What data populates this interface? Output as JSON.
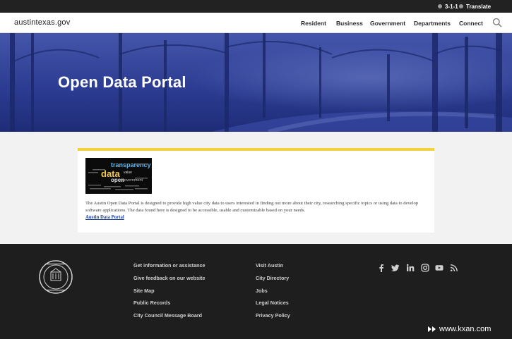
{
  "utility": {
    "item1": "3-1-1",
    "item2": "Translate"
  },
  "nav": {
    "logo": "austintexas.gov",
    "links": [
      "Resident",
      "Business",
      "Government",
      "Departments",
      "Connect"
    ]
  },
  "hero": {
    "title": "Open Data Portal"
  },
  "card": {
    "image_words": {
      "transparency": "transparency",
      "data": "data",
      "open": "open",
      "government": "government",
      "value": "value"
    },
    "description": "The Austin Open Data Portal is designed to provide high value city data to users interested in finding out more about their city, researching specific topics or using data to develop software applications. The data found here is designed to be accessible, usable and customizable based on your needs.",
    "link": "Austin Data Portal"
  },
  "footer": {
    "col1": [
      "Get information or assistance",
      "Give feedback on our website",
      "Site Map",
      "Public Records",
      "City Council Message Board"
    ],
    "col2": [
      "Visit Austin",
      "City Directory",
      "Jobs",
      "Legal Notices",
      "Privacy Policy"
    ]
  },
  "watermark": "www.kxan.com",
  "colors": {
    "accent_yellow": "#f2d13a",
    "hero_blue": "#2b3a8f",
    "link_blue": "#1a3ea8",
    "footer_bg": "#1e1e1e"
  }
}
